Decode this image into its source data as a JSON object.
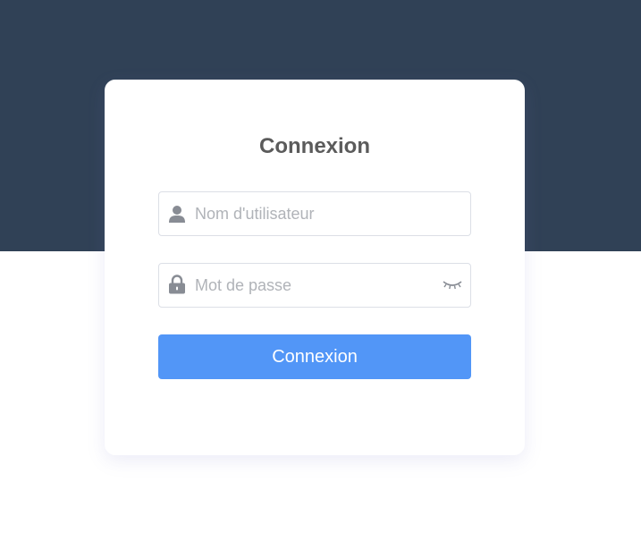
{
  "login": {
    "title": "Connexion",
    "username": {
      "placeholder": "Nom d'utilisateur",
      "value": "",
      "icon": "user-icon"
    },
    "password": {
      "placeholder": "Mot de passe",
      "value": "",
      "icon": "lock-icon",
      "toggle_icon": "eye-closed-icon"
    },
    "submit_label": "Connexion"
  },
  "colors": {
    "header_background": "#304156",
    "page_background": "#ffffff",
    "button": "#5296f7",
    "title_text": "#5b5b5b",
    "icon": "#888c94",
    "placeholder": "#b0b3b8",
    "input_border": "#dcdfe6"
  }
}
